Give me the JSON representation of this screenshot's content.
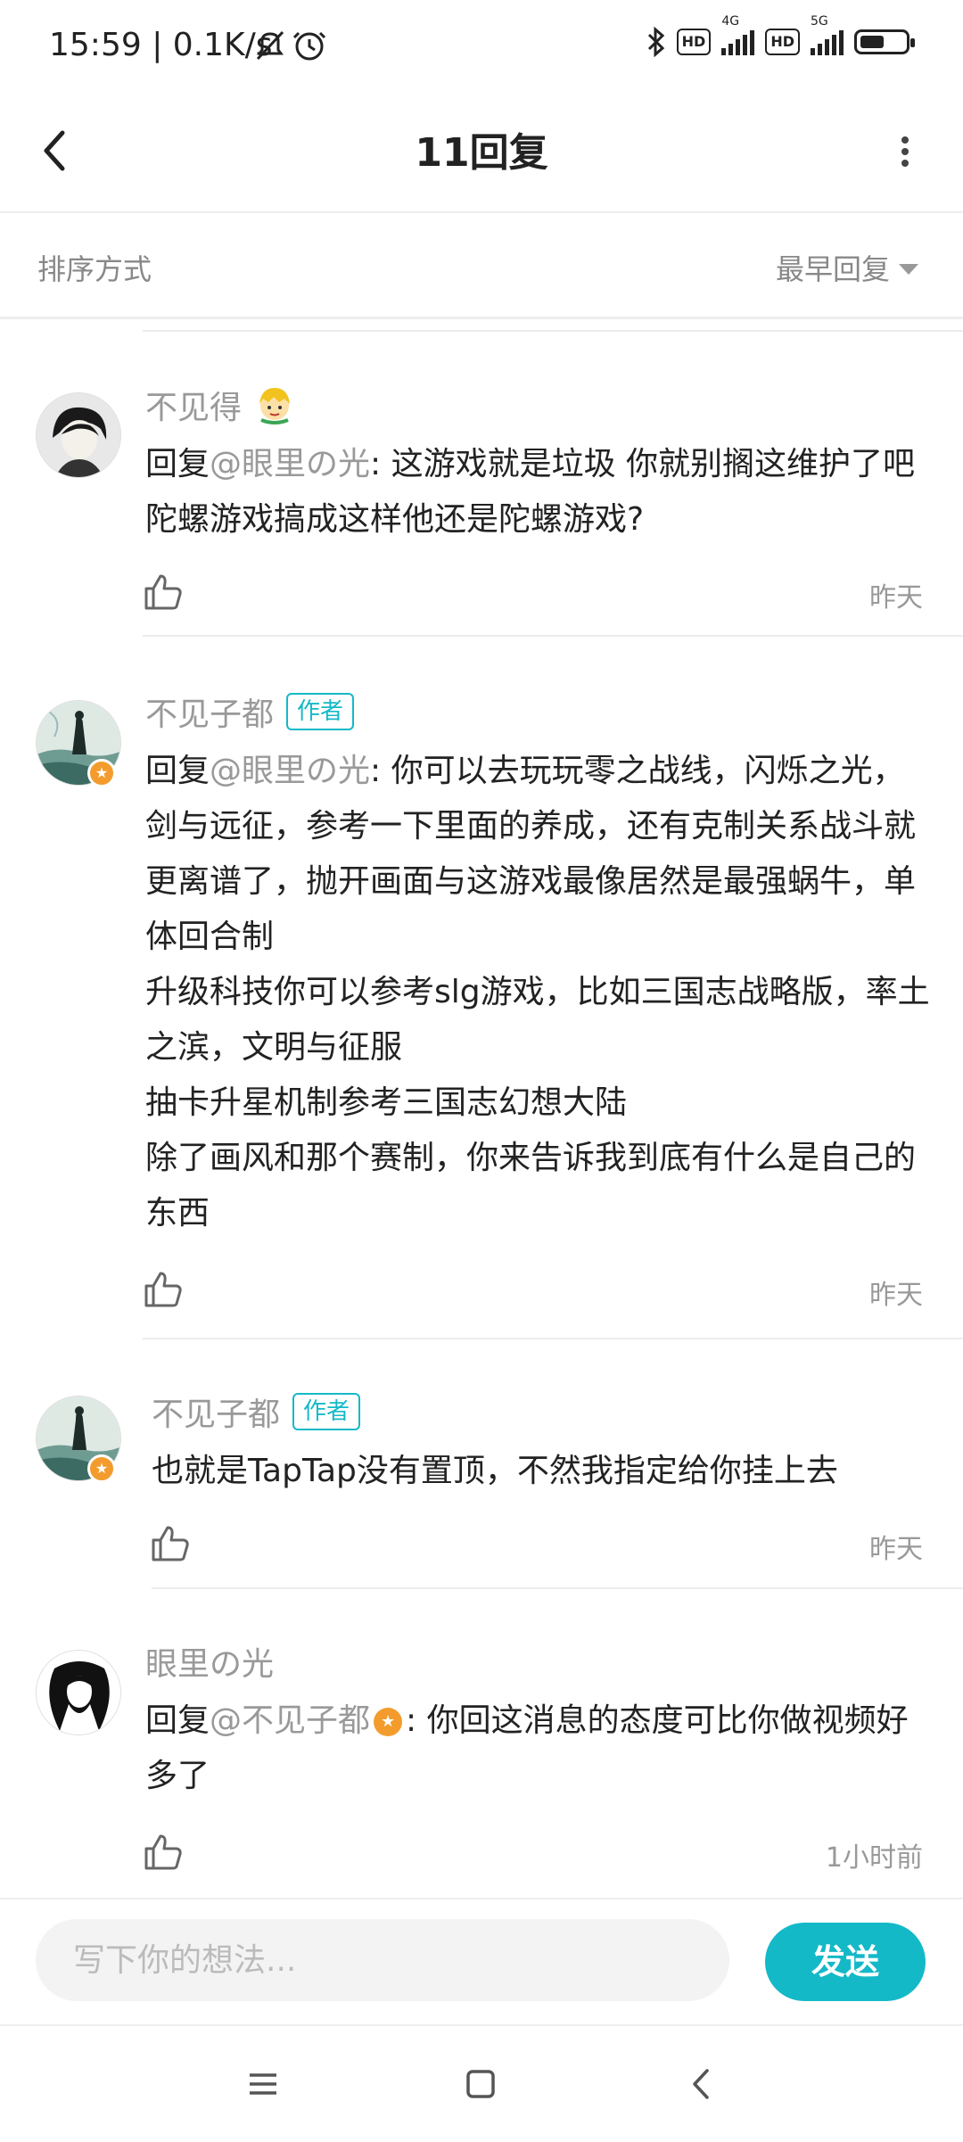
{
  "status_bar": {
    "time": "15:59 | 0.1K/s",
    "hd1": "HD",
    "net1": "4G",
    "hd2": "HD",
    "net2": "5G"
  },
  "header": {
    "title": "11回复"
  },
  "sort": {
    "label": "排序方式",
    "selected": "最早回复"
  },
  "comments": [
    {
      "name": "不见得",
      "reply_prefix": "回复",
      "mention": "@眼里の光",
      "text": ": 这游戏就是垃圾 你就别搁这维护了吧 陀螺游戏搞成这样他还是陀螺游戏?",
      "time": "昨天"
    },
    {
      "name": "不见子都",
      "tag": "作者",
      "reply_prefix": "回复",
      "mention": "@眼里の光",
      "text": ": 你可以去玩玩零之战线，闪烁之光，剑与远征，参考一下里面的养成，还有克制关系战斗就更离谱了，抛开画面与这游戏最像居然是最强蜗牛，单体回合制\n升级科技你可以参考slg游戏，比如三国志战略版，率土之滨，文明与征服\n抽卡升星机制参考三国志幻想大陆\n除了画风和那个赛制，你来告诉我到底有什么是自己的东西",
      "time": "昨天"
    },
    {
      "name": "不见子都",
      "tag": "作者",
      "text": "也就是TapTap没有置顶，不然我指定给你挂上去",
      "time": "昨天"
    },
    {
      "name": "眼里の光",
      "reply_prefix": "回复",
      "mention": "@不见子都",
      "text": ": 你回这消息的态度可比你做视频好多了",
      "time": "1小时前"
    }
  ],
  "input": {
    "placeholder": "写下你的想法...",
    "send_label": "发送"
  },
  "colors": {
    "accent": "#14b9c8",
    "badge": "#f39c2d",
    "muted": "#999999"
  }
}
